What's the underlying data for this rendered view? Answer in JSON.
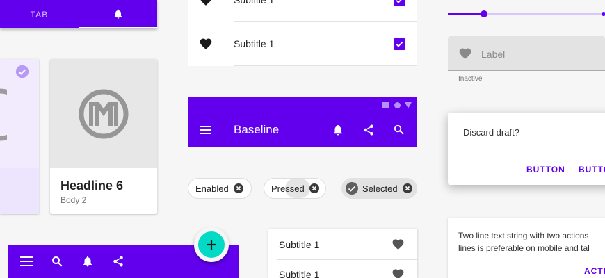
{
  "colors": {
    "primary": "#6200ee",
    "secondary": "#03dac5",
    "surface": "#ffffff",
    "background": "#f6f6f6"
  },
  "tabs": {
    "first_label": "TAB",
    "second_icon": "bell-icon"
  },
  "card": {
    "headline": "Headline 6",
    "body": "Body 2",
    "media_icon": "logo-icon"
  },
  "list_top": {
    "row_label": "Subtitle 1",
    "row_label_partial": "Subtitle 1",
    "icon": "heart-icon",
    "control": "checkbox-checked"
  },
  "app_bar": {
    "title": "Baseline",
    "actions": [
      "bell-icon",
      "share-icon",
      "search-icon"
    ],
    "status_icons": [
      "square-icon",
      "circle-icon",
      "triangle-icon"
    ]
  },
  "chips": [
    {
      "label": "Enabled"
    },
    {
      "label": "Pressed"
    },
    {
      "label": "Selected"
    }
  ],
  "list_bottom": {
    "items": [
      {
        "label": "Subtitle 1"
      },
      {
        "label": "Subtitle 1"
      }
    ]
  },
  "bottom_bar": {
    "actions": [
      "menu-icon",
      "search-icon",
      "bell-icon",
      "share-icon"
    ],
    "fab_icon": "plus-icon"
  },
  "slider": {
    "value_fraction": 0.23
  },
  "text_field": {
    "label": "Label",
    "helper": "Inactive"
  },
  "dialog": {
    "message": "Discard draft?",
    "button1": "BUTTON",
    "button2": "BUTTO"
  },
  "banner": {
    "line1": "Two line text string with two actions",
    "line2": "lines is preferable on mobile and tal",
    "action": "ACTI"
  }
}
